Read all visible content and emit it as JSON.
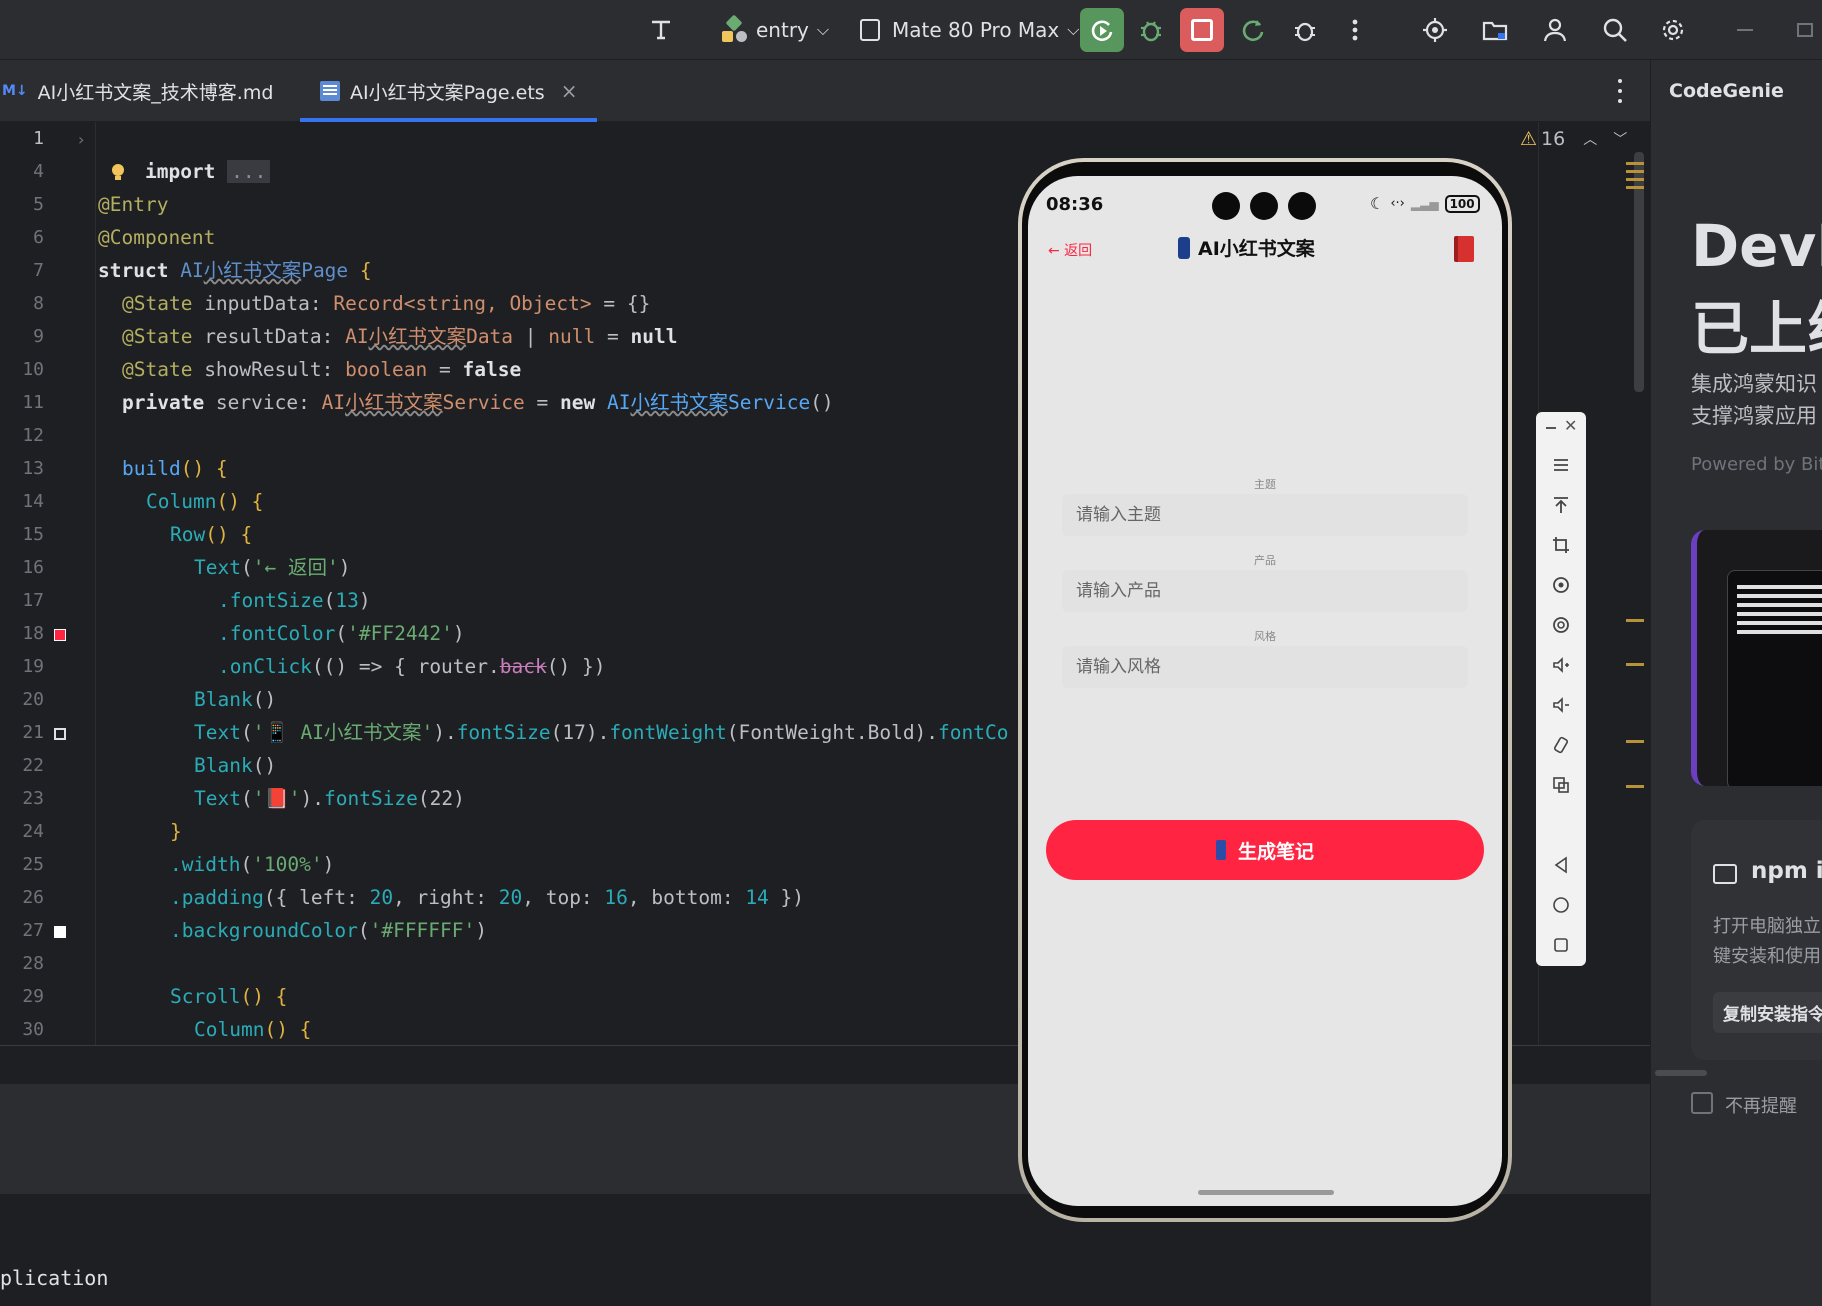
{
  "toolbar": {
    "module": "entry",
    "device": "Mate 80 Pro Max"
  },
  "tabs": [
    {
      "badge": "M↓",
      "label": "AI小红书文案_技术博客.md"
    },
    {
      "label": "AI小红书文案Page.ets",
      "close": "×"
    }
  ],
  "editor": {
    "warnings_count": "16",
    "line_numbers": [
      "1",
      "4",
      "5",
      "6",
      "7",
      "8",
      "9",
      "10",
      "11",
      "12",
      "13",
      "14",
      "15",
      "16",
      "17",
      "18",
      "19",
      "20",
      "21",
      "22",
      "23",
      "24",
      "25",
      "26",
      "27",
      "28",
      "29",
      "30"
    ],
    "lines": {
      "l1_kw": "import",
      "l1_fold": "...",
      "l5": "@Entry",
      "l6": "@Component",
      "l7_kw": "struct",
      "l7_name_a": "AI",
      "l7_name_b": "小红书文案",
      "l7_name_c": "Page",
      "l7_brace": " {",
      "l8_an": "@State",
      "l8_name": " inputData: ",
      "l8_type": "Record<string, Object>",
      "l8_rest": " = {}",
      "l9_an": "@State",
      "l9_name": " resultData: ",
      "l9_type_a": "AI",
      "l9_type_b": "小红书文案",
      "l9_type_c": "Data",
      "l9_rest_a": " | ",
      "l9_null1": "null",
      "l9_eq": " = ",
      "l9_null2": "null",
      "l10_an": "@State",
      "l10_name": " showResult: ",
      "l10_type": "boolean",
      "l10_eq": " = ",
      "l10_val": "false",
      "l11_kw": "private",
      "l11_name": " service: ",
      "l11_type_a": "AI",
      "l11_type_b": "小红书文案",
      "l11_type_c": "Service",
      "l11_eq": " = ",
      "l11_new": "new",
      "l11_ctor_a": " AI",
      "l11_ctor_b": "小红书文案",
      "l11_ctor_c": "Service",
      "l11_paren": "()",
      "l13_fn": "build",
      "l13_rest": "() {",
      "l14_fn": "Column",
      "l14_rest": "() {",
      "l15_fn": "Row",
      "l15_rest": "() {",
      "l16_fn": "Text",
      "l16_open": "(",
      "l16_str": "'← 返回'",
      "l16_close": ")",
      "l17_fn": ".fontSize",
      "l17_open": "(",
      "l17_num": "13",
      "l17_close": ")",
      "l18_fn": ".fontColor",
      "l18_open": "(",
      "l18_str": "'#FF2442'",
      "l18_close": ")",
      "l19_fn": ".onClick",
      "l19_a": "(() => { router.",
      "l19_back": "back",
      "l19_b": "() })",
      "l20_fn": "Blank",
      "l20_rest": "()",
      "l21_fn": "Text",
      "l21_open": "(",
      "l21_str": "'📱 AI小红书文案'",
      "l21_mid": ").",
      "l21_fs": "fontSize",
      "l21_n": "(17).",
      "l21_fw": "fontWeight",
      "l21_fwv": "(FontWeight.Bold).",
      "l21_fc": "fontCo",
      "l22_fn": "Blank",
      "l22_rest": "()",
      "l23_fn": "Text",
      "l23_open": "(",
      "l23_str": "'📕'",
      "l23_mid": ").",
      "l23_fs": "fontSize",
      "l23_n": "(22)",
      "l24": "}",
      "l25_fn": ".width",
      "l25_open": "(",
      "l25_str": "'100%'",
      "l25_close": ")",
      "l26_fn": ".padding",
      "l26_a": "({ left: ",
      "l26_n1": "20",
      "l26_b": ", right: ",
      "l26_n2": "20",
      "l26_c": ", top: ",
      "l26_n3": "16",
      "l26_d": ", bottom: ",
      "l26_n4": "14",
      "l26_e": " })",
      "l27_fn": ".backgroundColor",
      "l27_open": "(",
      "l27_str": "'#FFFFFF'",
      "l27_close": ")",
      "l29_fn": "Scroll",
      "l29_rest": "() {",
      "l30_fn": "Column",
      "l30_rest": "() {"
    }
  },
  "bottom_text": "plication",
  "phone": {
    "time": "08:36",
    "battery": "100",
    "back": "← 返回",
    "title": "AI小红书文案",
    "form": [
      {
        "label": "主题",
        "placeholder": "请输入主题"
      },
      {
        "label": "产品",
        "placeholder": "请输入产品"
      },
      {
        "label": "风格",
        "placeholder": "请输入风格"
      }
    ],
    "generate": "生成笔记",
    "accent": "#FF2442"
  },
  "right_panel": {
    "title": "CodeGenie",
    "hero_line1": "DevE",
    "hero_line2": "已上线",
    "desc1": "集成鸿蒙知识",
    "desc2": "支撑鸿蒙应用",
    "powered": "Powered by Biti",
    "npm_title": "npm in",
    "npm_desc1": "打开电脑独立",
    "npm_desc2": "键安装和使用",
    "copy_btn": "复制安装指令",
    "dont_remind": "不再提醒"
  }
}
